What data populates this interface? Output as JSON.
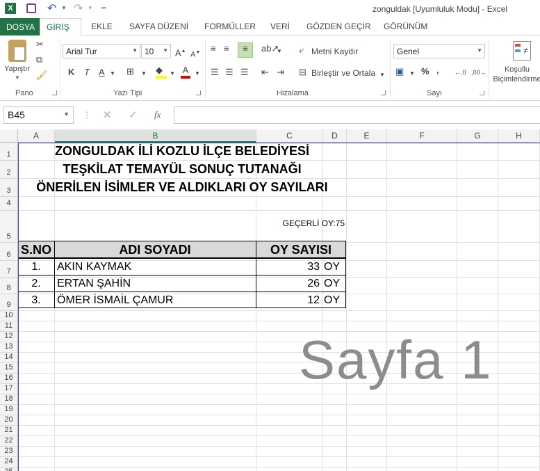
{
  "window": {
    "title": "zonguldak  [Uyumluluk Modu] - Excel"
  },
  "ribbon_tabs": {
    "file": "DOSYA",
    "home": "GİRİŞ",
    "insert": "EKLE",
    "page_layout": "SAYFA DÜZENİ",
    "formulas": "FORMÜLLER",
    "data": "VERİ",
    "review": "GÖZDEN GEÇİR",
    "view": "GÖRÜNÜM"
  },
  "ribbon": {
    "paste_label": "Yapıştır",
    "font_name": "Arial Tur",
    "font_size": "10",
    "bold": "K",
    "italic": "T",
    "underline": "A",
    "wrap_text": "Metni Kaydır",
    "merge_center": "Birleştir ve Ortala",
    "number_format": "Genel",
    "conditional_formatting": "Koşullu Biçimlendirme",
    "groups": {
      "clipboard": "Pano",
      "font": "Yazı Tipi",
      "alignment": "Hizalama",
      "number": "Sayı"
    }
  },
  "formula_bar": {
    "name_box": "B45",
    "fx": "fx",
    "value": ""
  },
  "columns": [
    "A",
    "B",
    "C",
    "D",
    "E",
    "F",
    "G",
    "H"
  ],
  "rows": [
    "1",
    "2",
    "3",
    "4",
    "5",
    "6",
    "7",
    "8",
    "9",
    "10",
    "11",
    "12",
    "13",
    "14",
    "15",
    "16",
    "17",
    "18",
    "19",
    "20",
    "21",
    "22",
    "23",
    "24",
    "25"
  ],
  "sheet": {
    "title1": "ZONGULDAK İLİ KOZLU İLÇE BELEDİYESİ",
    "title2": "TEŞKİLAT TEMAYÜL SONUÇ TUTANAĞI",
    "title3": "ÖNERİLEN İSİMLER VE ALDIKLARI OY SAYILARI",
    "valid_votes": "GEÇERLİ OY:75",
    "headers": {
      "no": "S.NO",
      "name": "ADI SOYADI",
      "votes": "OY SAYISI"
    },
    "rows": [
      {
        "no": "1.",
        "name": "AKIN KAYMAK",
        "votes": "33",
        "unit": "OY"
      },
      {
        "no": "2.",
        "name": "ERTAN ŞAHİN",
        "votes": "26",
        "unit": "OY"
      },
      {
        "no": "3.",
        "name": "ÖMER İSMAİL ÇAMUR",
        "votes": "12",
        "unit": "OY"
      }
    ]
  },
  "watermark": "Sayfa 1"
}
